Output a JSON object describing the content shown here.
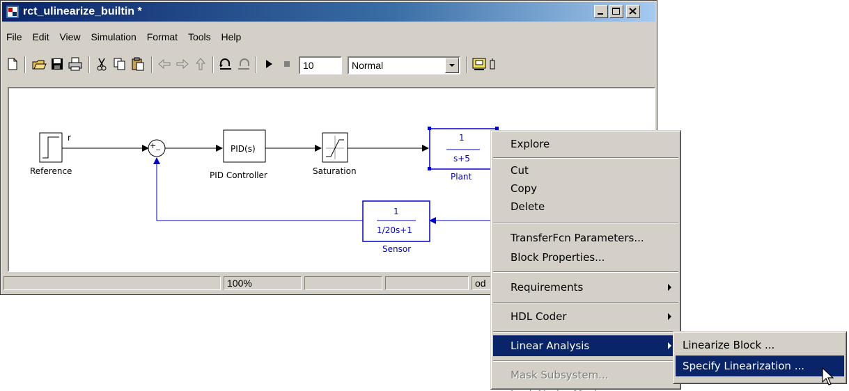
{
  "window": {
    "title": "rct_ulinearize_builtin *"
  },
  "menu": [
    "File",
    "Edit",
    "View",
    "Simulation",
    "Format",
    "Tools",
    "Help"
  ],
  "toolbar": {
    "stop_time": "10",
    "sim_mode": "Normal"
  },
  "diagram": {
    "reference_label": "Reference",
    "signal_r": "r",
    "sum_text": "+_",
    "pid_text": "PID(s)",
    "pid_label": "PID Controller",
    "saturation_label": "Saturation",
    "plant_num": "1",
    "plant_den": "s+5",
    "plant_label": "Plant",
    "sensor_num": "1",
    "sensor_den": "1/20s+1",
    "sensor_label": "Sensor"
  },
  "status": {
    "zoom": "100%",
    "solver": "od"
  },
  "context_menu": {
    "explore": "Explore",
    "cut": "Cut",
    "copy": "Copy",
    "delete": "Delete",
    "tf_params": "TransferFcn Parameters...",
    "block_props": "Block Properties...",
    "requirements": "Requirements",
    "hdl_coder": "HDL Coder",
    "linear_analysis": "Linear Analysis",
    "mask_subsystem": "Mask Subsystem...",
    "look_under_mask": "Look Under Mask"
  },
  "submenu": {
    "linearize_block": "Linearize Block ...",
    "specify_linearization": "Specify Linearization ..."
  },
  "colors": {
    "titlebar": "#0a246a",
    "highlight": "#0a246a",
    "block_blue": "#0000cc"
  }
}
